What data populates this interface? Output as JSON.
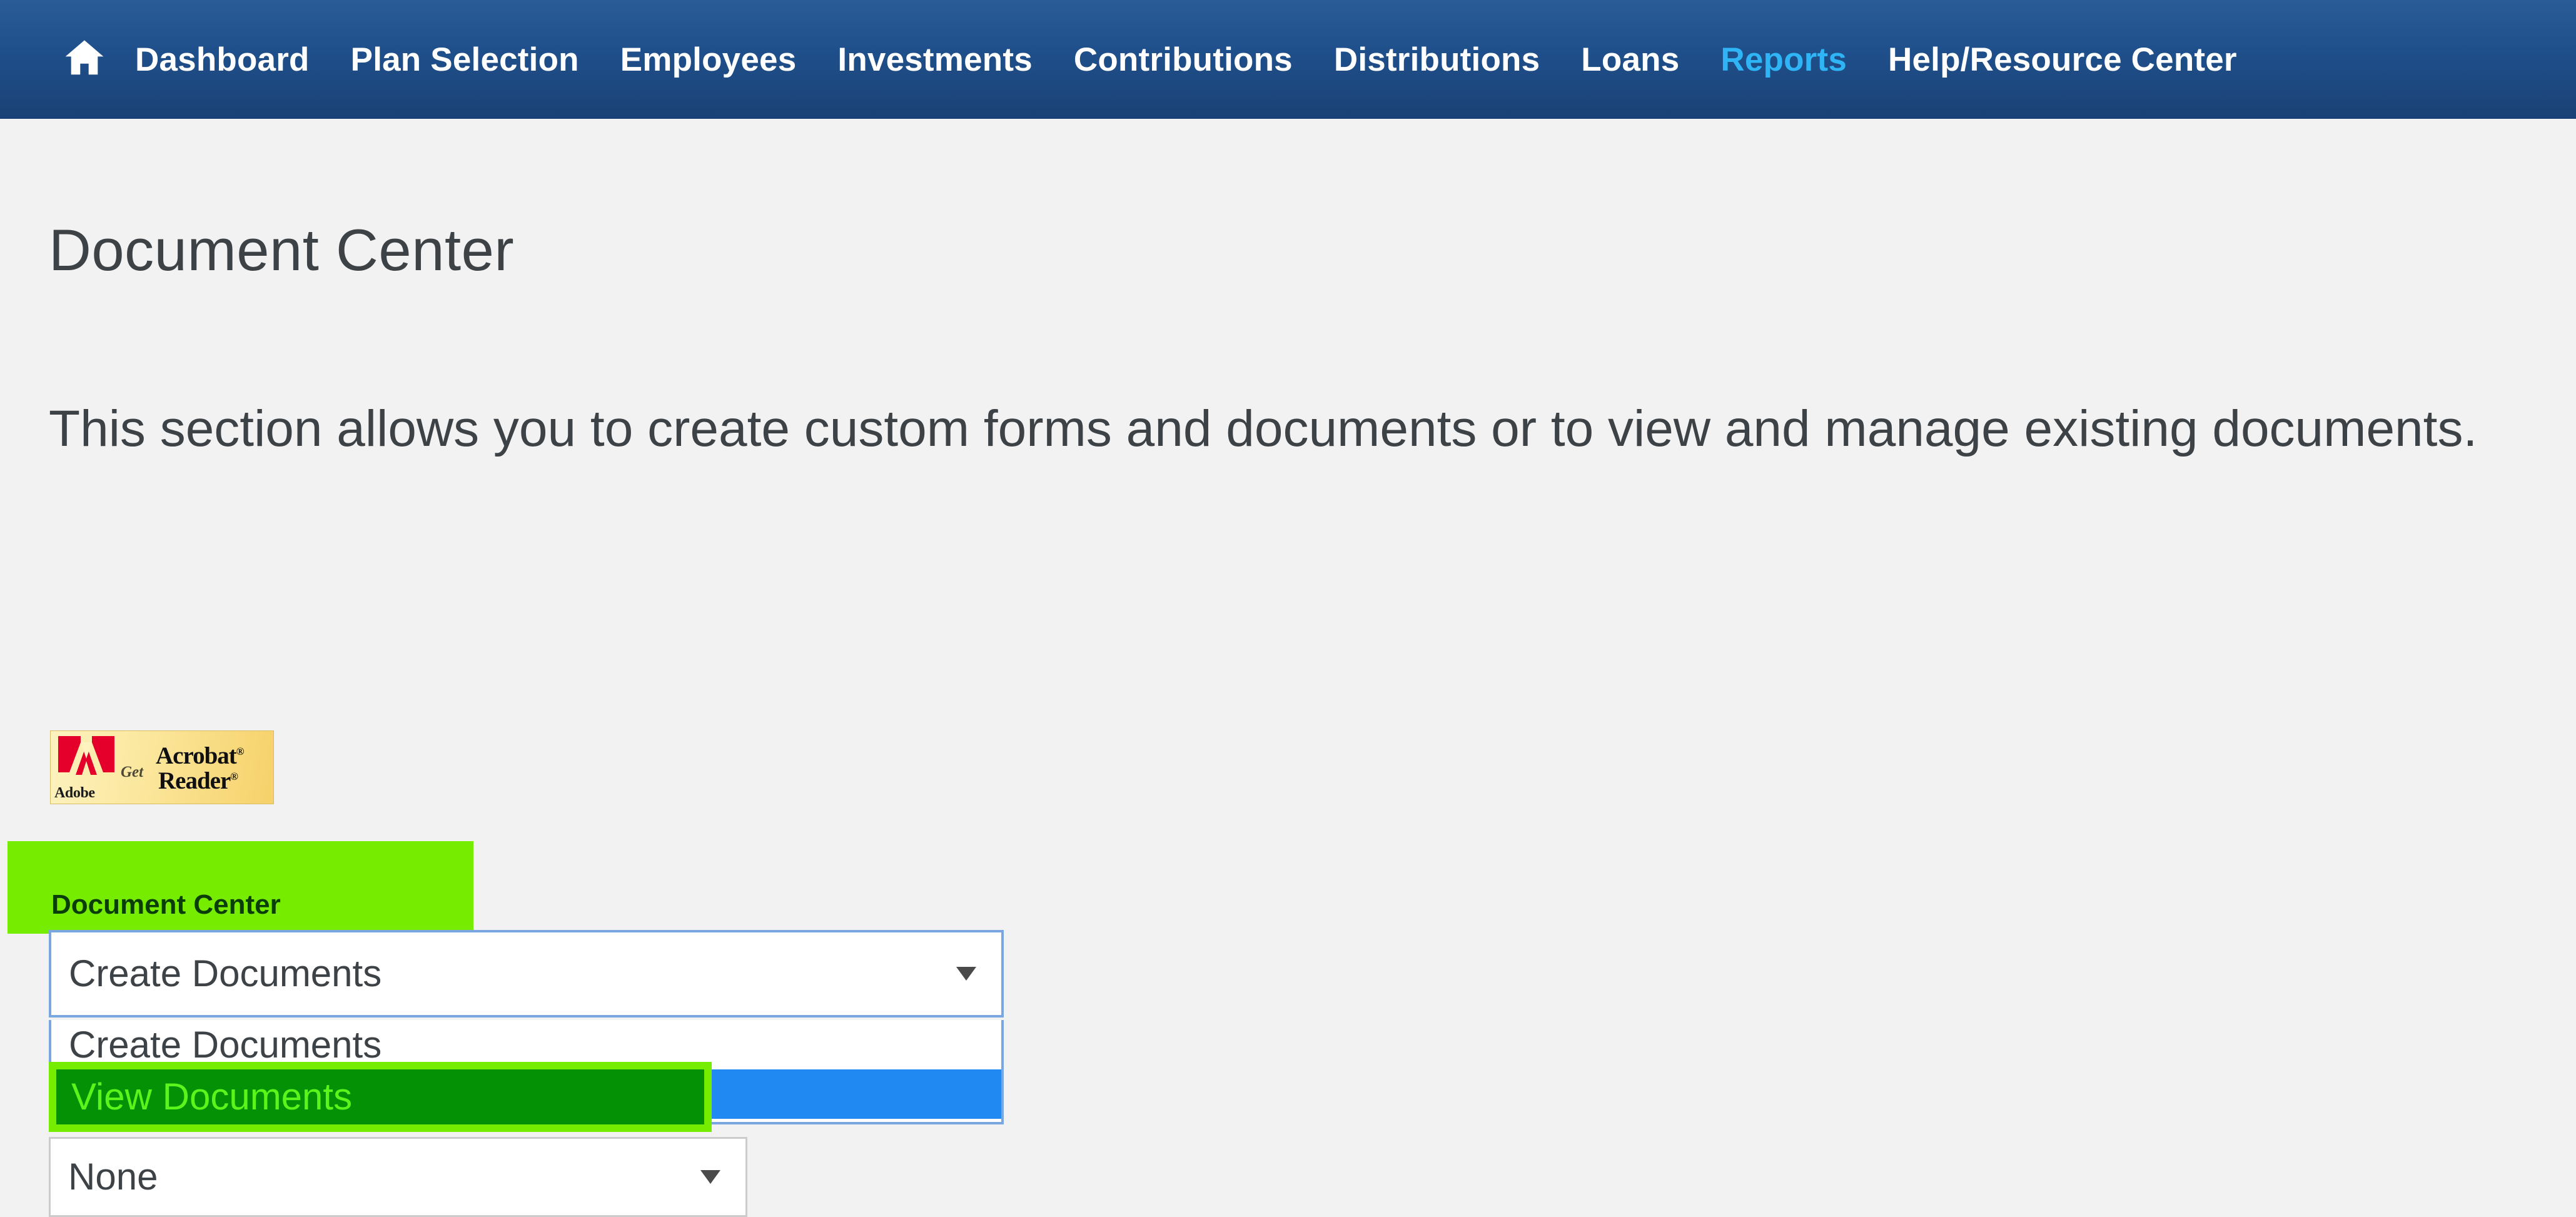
{
  "navbar": {
    "home_icon": "home-icon",
    "items": [
      {
        "label": "Dashboard",
        "active": false
      },
      {
        "label": "Plan Selection",
        "active": false
      },
      {
        "label": "Employees",
        "active": false
      },
      {
        "label": "Investments",
        "active": false
      },
      {
        "label": "Contributions",
        "active": false
      },
      {
        "label": "Distributions",
        "active": false
      },
      {
        "label": "Loans",
        "active": false
      },
      {
        "label": "Reports",
        "active": true
      },
      {
        "label": "Help/Resource Center",
        "active": false
      }
    ],
    "active_color": "#2fb4f5",
    "background_start": "#2a5c98",
    "background_end": "#1a4175"
  },
  "main": {
    "title": "Document Center",
    "description": "This section allows you to create custom forms and documents or to view and manage existing documents."
  },
  "acrobat_badge": {
    "brand": "Adobe",
    "get": "Get",
    "word1": "Acrobat",
    "word2": "Reader",
    "registered_mark": "®",
    "background_color": "#f6d169",
    "logo_color": "#e4002b"
  },
  "annotations": {
    "document_center_label": "Document Center",
    "document_center_label_bg": "#76ed00",
    "document_center_label_fg": "#0b3d08",
    "view_documents_label": "View Documents",
    "view_documents_bg": "#049105",
    "view_documents_border": "#76ed00",
    "view_documents_fg": "#5af51a"
  },
  "document_center_select": {
    "value": "Create Documents",
    "caret_icon": "chevron-down-icon",
    "expanded": true,
    "focus_border_color": "#7ba7e0",
    "options": [
      {
        "label": "Create Documents",
        "selected": false
      },
      {
        "label": "View Documents",
        "selected": true
      }
    ]
  },
  "plan_select": {
    "value": "None",
    "caret_icon": "chevron-down-icon",
    "border_color": "#cccccc"
  }
}
